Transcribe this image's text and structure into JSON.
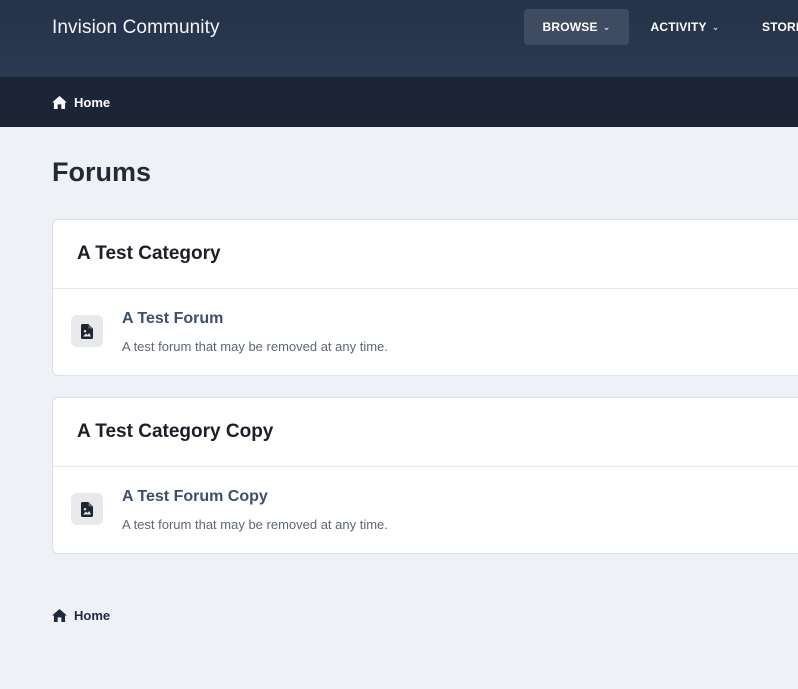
{
  "header": {
    "site_title": "Invision Community",
    "nav": [
      {
        "label": "BROWSE"
      },
      {
        "label": "ACTIVITY"
      },
      {
        "label": "STORE"
      }
    ]
  },
  "breadcrumb": {
    "home_label": "Home"
  },
  "page": {
    "title": "Forums"
  },
  "categories": [
    {
      "title": "A Test Category",
      "forums": [
        {
          "name": "A Test Forum",
          "description": "A test forum that may be removed at any time.",
          "icon": "file-image-icon"
        }
      ]
    },
    {
      "title": "A Test Category Copy",
      "forums": [
        {
          "name": "A Test Forum Copy",
          "description": "A test forum that may be removed at any time.",
          "icon": "file-image-icon"
        }
      ]
    }
  ],
  "footer_breadcrumb": {
    "home_label": "Home"
  },
  "colors": {
    "header_bg": "#253248",
    "breadcrumb_bg": "#1c2536",
    "page_bg": "#eef1f5",
    "active_nav_bg": "#3e4b60",
    "forum_link": "#3c4f6c"
  }
}
